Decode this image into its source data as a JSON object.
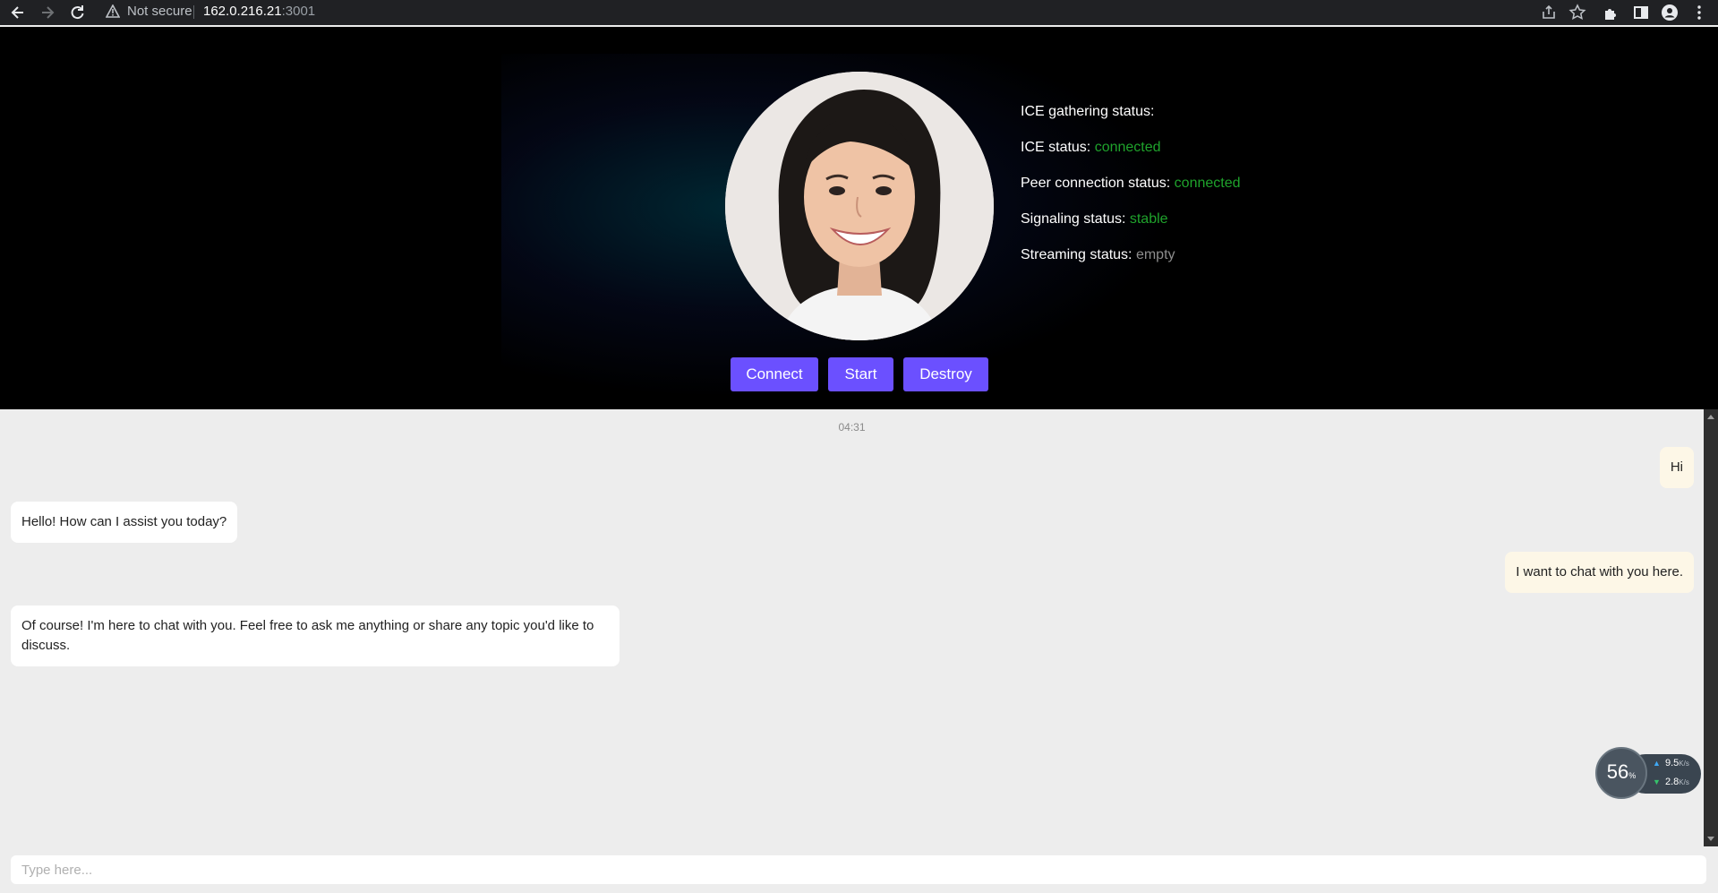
{
  "browser": {
    "security_label": "Not secure",
    "url_host": "162.0.216.21",
    "url_port": ":3001"
  },
  "status": {
    "ice_gathering": {
      "label": "ICE gathering status:",
      "value": ""
    },
    "ice": {
      "label": "ICE status:",
      "value": "connected"
    },
    "peer": {
      "label": "Peer connection status:",
      "value": "connected"
    },
    "signaling": {
      "label": "Signaling status:",
      "value": "stable"
    },
    "streaming": {
      "label": "Streaming status:",
      "value": "empty"
    }
  },
  "controls": {
    "connect": "Connect",
    "start": "Start",
    "destroy": "Destroy"
  },
  "chat": {
    "timestamp": "04:31",
    "messages": [
      {
        "role": "user",
        "text": "Hi"
      },
      {
        "role": "assistant",
        "text": "Hello! How can I assist you today?"
      },
      {
        "role": "user",
        "text": "I want to chat with you here."
      },
      {
        "role": "assistant",
        "text": "Of course! I'm here to chat with you. Feel free to ask me anything or share any topic you'd like to discuss."
      }
    ]
  },
  "network_widget": {
    "percent": "56",
    "percent_unit": "%",
    "upload": "9.5",
    "download": "2.8",
    "rate_unit": "K/s"
  },
  "composer": {
    "placeholder": "Type here...",
    "value": ""
  },
  "colors": {
    "accent": "#6b50ff",
    "status_ok": "#1fa32c",
    "status_idle": "#8d8d8d",
    "user_bubble": "#fdf7e7"
  }
}
